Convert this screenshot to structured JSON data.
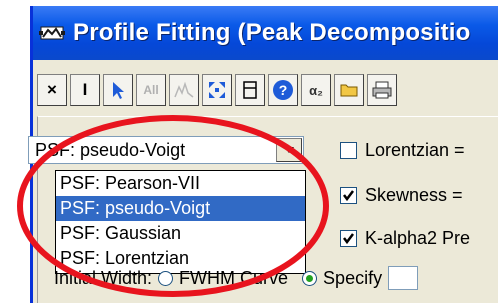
{
  "window": {
    "title": "Profile Fitting (Peak Decompositio"
  },
  "toolbar": {
    "buttons": [
      {
        "label": "×",
        "icon": "close-icon",
        "enabled": true
      },
      {
        "label": "I",
        "icon": "text-cursor-icon",
        "enabled": true
      },
      {
        "label": "",
        "icon": "cursor-arrow-icon",
        "enabled": true
      },
      {
        "label": "All",
        "icon": "all-peaks-icon",
        "enabled": false
      },
      {
        "label": "",
        "icon": "peak-shape-icon",
        "enabled": false
      },
      {
        "label": "",
        "icon": "expand-arrows-icon",
        "enabled": true
      },
      {
        "label": "",
        "icon": "panel-icon",
        "enabled": true
      },
      {
        "label": "?",
        "icon": "help-icon",
        "enabled": true
      },
      {
        "label": "α₂",
        "icon": "alpha2-icon",
        "enabled": true
      },
      {
        "label": "",
        "icon": "folder-icon",
        "enabled": true
      },
      {
        "label": "",
        "icon": "printer-icon",
        "enabled": true
      }
    ]
  },
  "psf_select": {
    "value": "PSF: pseudo-Voigt",
    "options": [
      "PSF: Pearson-VII",
      "PSF: pseudo-Voigt",
      "PSF: Gaussian",
      "PSF: Lorentzian"
    ],
    "selected_index": 1
  },
  "checkboxes": {
    "lorentzian": {
      "label": "Lorentzian =",
      "checked": false
    },
    "skewness": {
      "label": "Skewness =",
      "checked": true
    },
    "kalpha2": {
      "label": "K-alpha2 Pre",
      "checked": true
    }
  },
  "initial_width": {
    "label": "Initial Width:",
    "fwhm_label": "FWHM Curve",
    "specify_label": "Specify",
    "selected": "specify"
  },
  "colors": {
    "title_bar": "#0a5ae8",
    "selection": "#316ac5",
    "annotation_ellipse": "#e8141e"
  }
}
